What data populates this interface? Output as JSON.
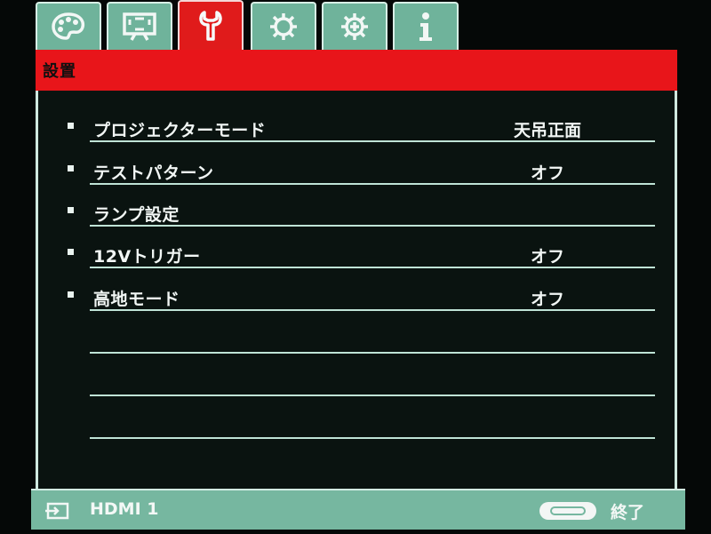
{
  "tabs": [
    {
      "icon": "palette-icon",
      "active": false
    },
    {
      "icon": "screen-icon",
      "active": false
    },
    {
      "icon": "wrench-icon",
      "active": true
    },
    {
      "icon": "gear-icon",
      "active": false
    },
    {
      "icon": "advanced-gear-icon",
      "active": false
    },
    {
      "icon": "info-icon",
      "active": false
    }
  ],
  "header": {
    "title": "設置"
  },
  "menu": {
    "items": [
      {
        "label": "プロジェクターモード",
        "value": "天吊正面"
      },
      {
        "label": "テストパターン",
        "value": "オフ"
      },
      {
        "label": "ランプ設定",
        "value": ""
      },
      {
        "label": "12Vトリガー",
        "value": "オフ"
      },
      {
        "label": "高地モード",
        "value": "オフ"
      }
    ]
  },
  "footer": {
    "source": "HDMI 1",
    "exit_label": "終了"
  },
  "colors": {
    "tab_inactive": "#6fb39b",
    "tab_active": "#e01b1b",
    "header_bar": "#e8151a",
    "panel_bg": "#0a1310",
    "divider": "#bfe3d6",
    "footer_bg": "#76b7a0"
  }
}
